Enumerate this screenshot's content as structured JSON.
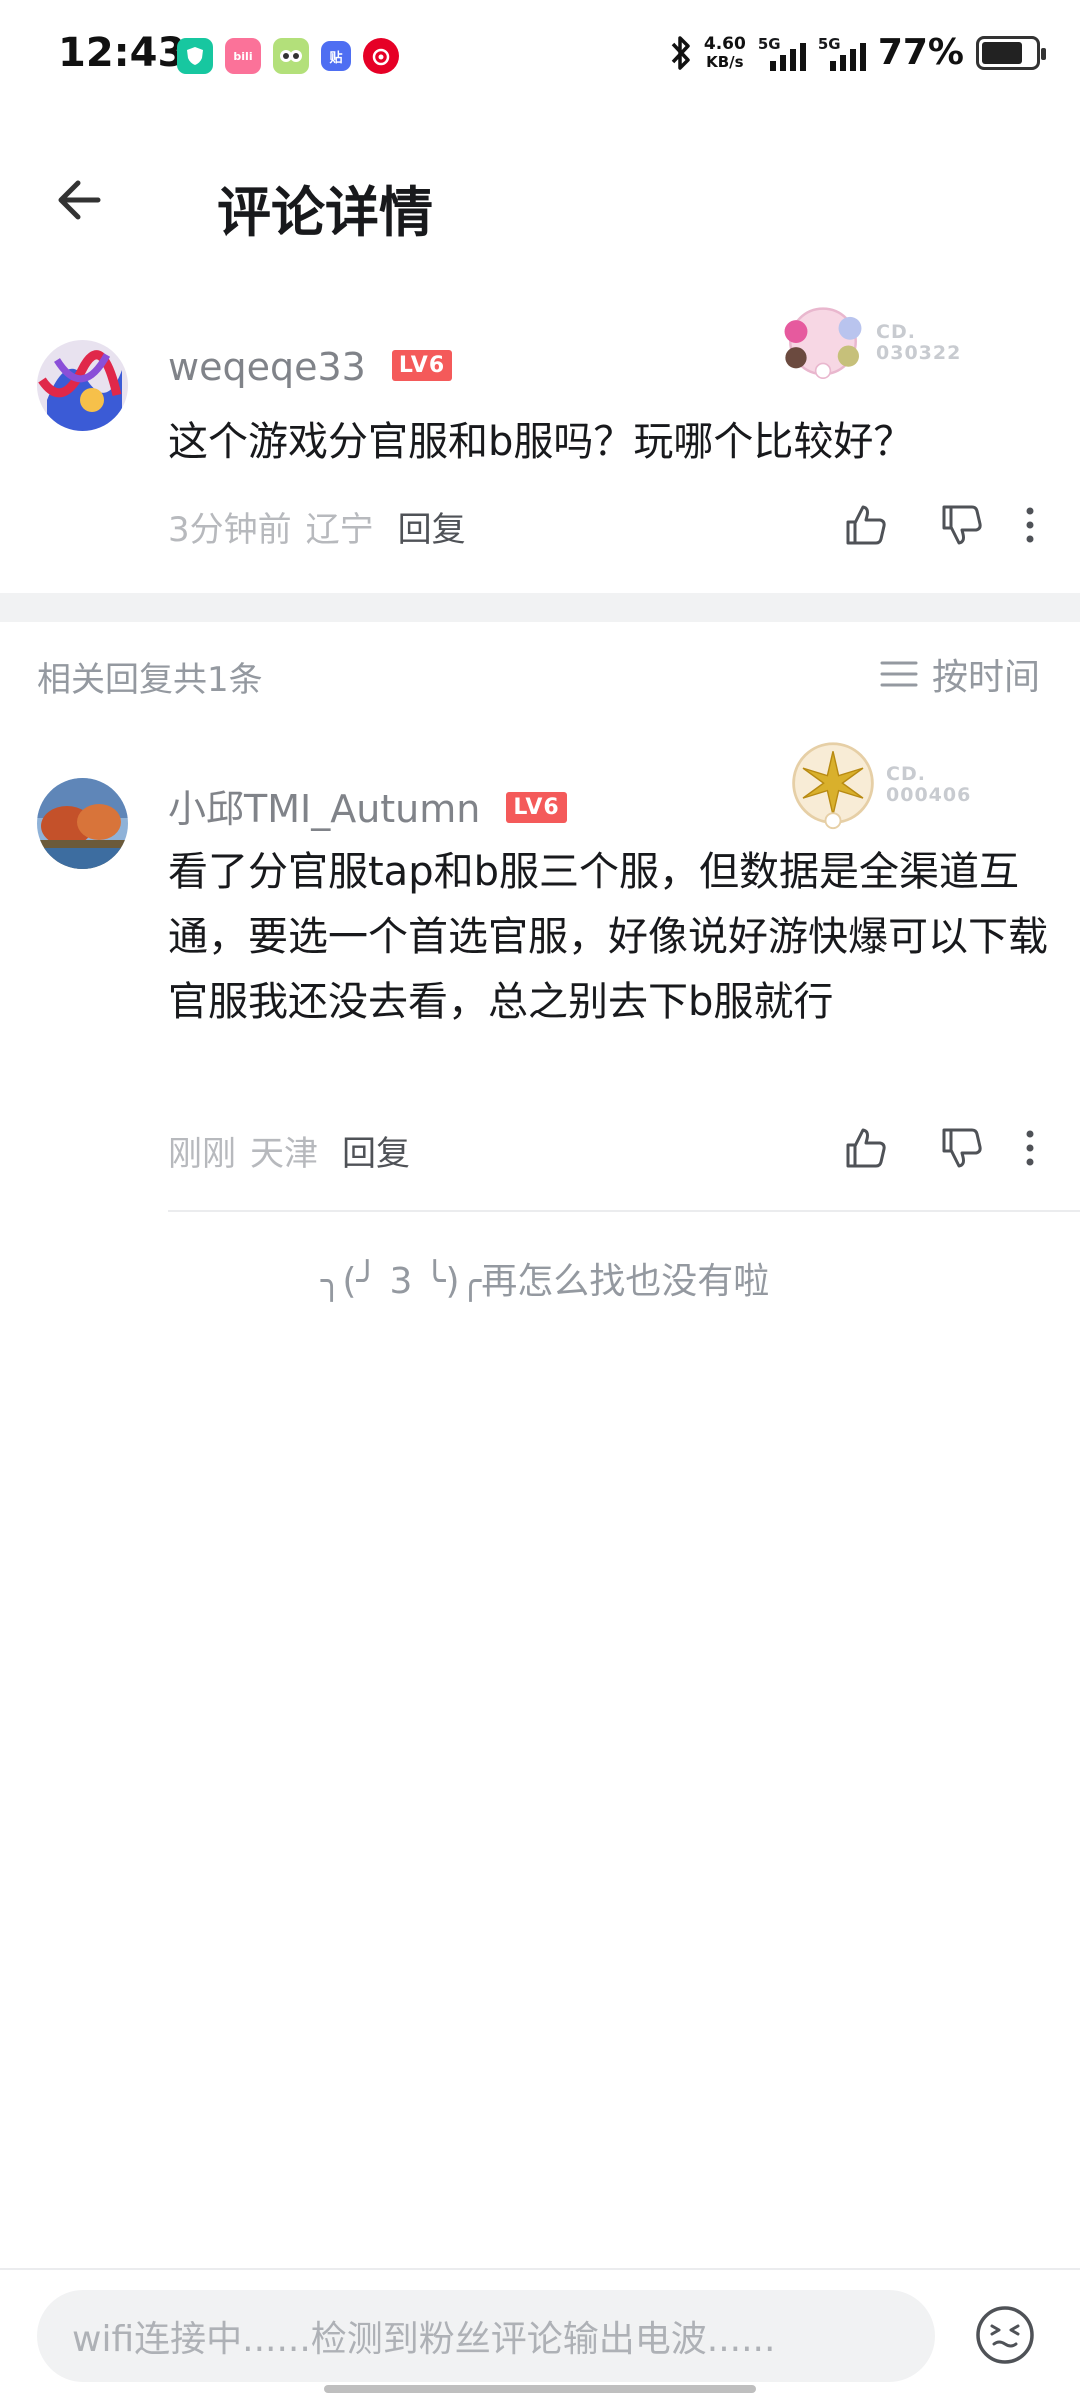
{
  "status_bar": {
    "time": "12:43",
    "net_speed_value": "4.60",
    "net_speed_unit": "KB/s",
    "signal1_label": "5G",
    "signal2_label": "5G",
    "battery_percent": "77%",
    "battery_level": 0.77,
    "app_icons": [
      "green-shield-app-icon",
      "bilibili-app-icon",
      "owl-app-icon",
      "tieba-app-icon",
      "netease-music-app-icon"
    ]
  },
  "header": {
    "title": "评论详情"
  },
  "main_comment": {
    "username": "weqeqe33",
    "level": "LV6",
    "badge_no_prefix": "CD.",
    "badge_no": "030322",
    "text": "这个游戏分官服和b服吗？玩哪个比较好？",
    "time": "3分钟前",
    "location": "辽宁",
    "reply_label": "回复"
  },
  "replies_header": {
    "count_text": "相关回复共1条",
    "sort_label": "按时间"
  },
  "reply": {
    "username": "小邱TMI_Autumn",
    "level": "LV6",
    "badge_no_prefix": "CD.",
    "badge_no": "000406",
    "text": "看了分官服tap和b服三个服，但数据是全渠道互通，要选一个首选官服，好像说好游快爆可以下载官服我还没去看，总之别去下b服就行",
    "time": "刚刚",
    "location": "天津",
    "reply_label": "回复"
  },
  "end_note": "╮(╯ 3 ╰)╭再怎么找也没有啦",
  "input": {
    "placeholder": "wifi连接中......检测到粉丝评论输出电波......"
  },
  "colors": {
    "level_badge": "#f45a5a",
    "text_primary": "#18191c",
    "text_secondary": "#9499a0"
  }
}
